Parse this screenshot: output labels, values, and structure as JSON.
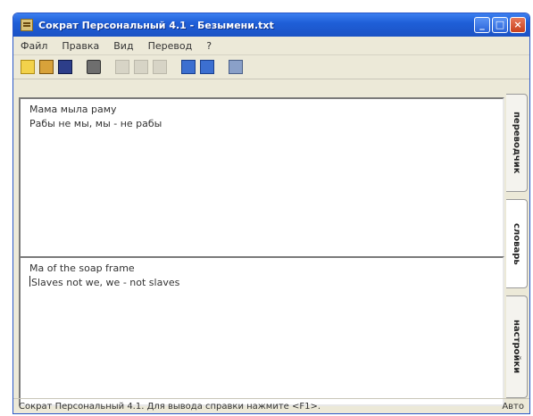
{
  "window": {
    "title": "Сократ Персональный 4.1 - Безымени.txt",
    "buttons": {
      "minimize": "_",
      "maximize": "□",
      "close": "×"
    }
  },
  "menu": [
    {
      "label": "Файл"
    },
    {
      "label": "Правка"
    },
    {
      "label": "Вид"
    },
    {
      "label": "Перевод"
    },
    {
      "label": "?"
    }
  ],
  "toolbar": {
    "icons": [
      "new-file-icon",
      "open-file-icon",
      "save-icon",
      "print-icon",
      "cut-icon",
      "copy-icon",
      "paste-icon",
      "translate-icon",
      "dictionary-icon",
      "help-icon"
    ]
  },
  "source_text": {
    "lines": [
      "Мама мыла раму",
      "Рабы не мы, мы - не рабы"
    ]
  },
  "translation_text": {
    "lines": [
      "Ma of the soap frame",
      "Slaves not we, we - not slaves"
    ]
  },
  "side_tabs": [
    {
      "label": "переводчик"
    },
    {
      "label": "словарь"
    },
    {
      "label": "настройки"
    }
  ],
  "status": {
    "left": "Сократ Персональный 4.1. Для вывода справки нажмите <F1>.",
    "right": "Авто"
  }
}
